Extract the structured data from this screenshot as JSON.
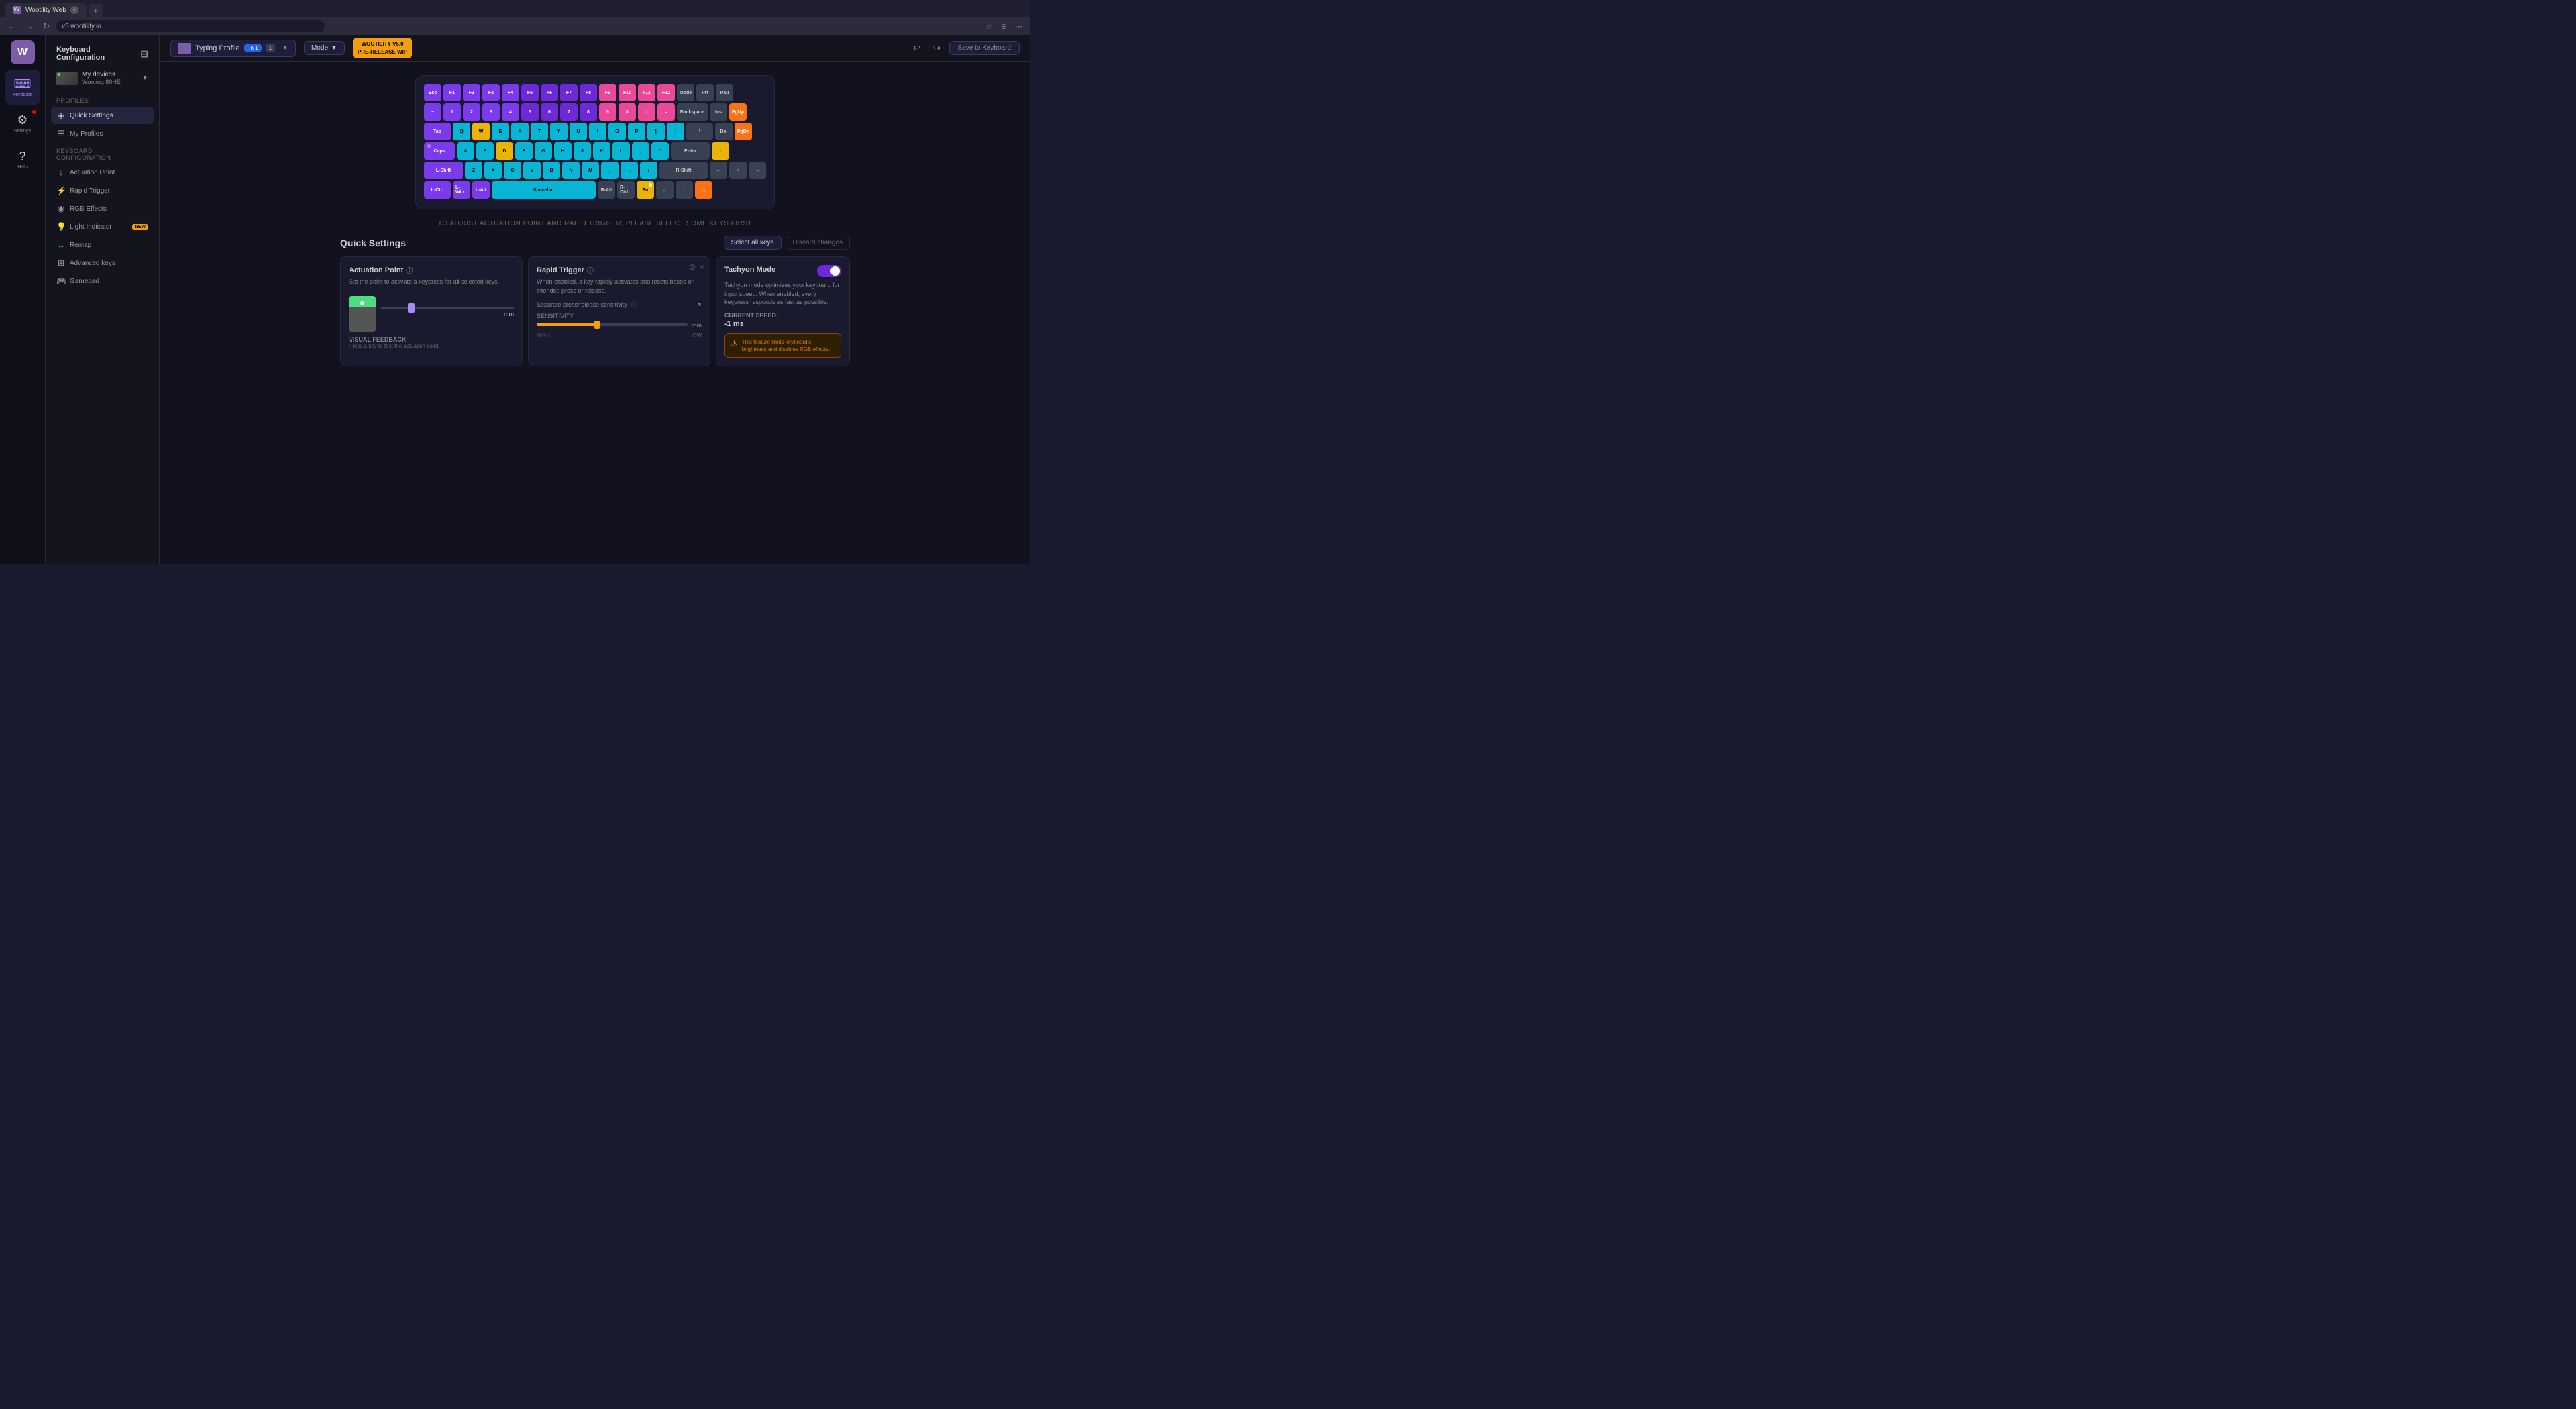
{
  "browser": {
    "tab_title": "Wootility Web",
    "url": "v5.wootility.io",
    "favicon": "W"
  },
  "sidebar": {
    "logo": "W",
    "items": [
      {
        "id": "keyboard",
        "icon": "⌨",
        "label": "Keyboard",
        "active": true
      },
      {
        "id": "settings",
        "icon": "⚙",
        "label": "Settings",
        "has_dot": true
      },
      {
        "id": "help",
        "icon": "?",
        "label": "Help"
      }
    ]
  },
  "nav_panel": {
    "title": "Keyboard Configuration",
    "device": {
      "name": "My devices",
      "model": "Wooting 80HE"
    },
    "sections": {
      "profiles": {
        "title": "Profiles",
        "items": [
          {
            "id": "quick-settings",
            "icon": "◈",
            "label": "Quick Settings",
            "active": true
          },
          {
            "id": "my-profiles",
            "icon": "☰",
            "label": "My Profiles"
          }
        ]
      },
      "keyboard_config": {
        "title": "Keyboard Configuration",
        "items": [
          {
            "id": "actuation-point",
            "icon": "↓",
            "label": "Actuation Point"
          },
          {
            "id": "rapid-trigger",
            "icon": "⚡",
            "label": "Rapid Trigger"
          },
          {
            "id": "rgb-effects",
            "icon": "◉",
            "label": "RGB Effects"
          },
          {
            "id": "light-indicator",
            "icon": "💡",
            "label": "Light Indicator",
            "badge": "NEW"
          },
          {
            "id": "remap",
            "icon": "↔",
            "label": "Remap"
          },
          {
            "id": "advanced-keys",
            "icon": "⊞",
            "label": "Advanced keys"
          },
          {
            "id": "gamepad",
            "icon": "🎮",
            "label": "Gamepad"
          }
        ]
      }
    }
  },
  "top_bar": {
    "profile_name": "Typing Profile",
    "profile_badge": "Fn 1",
    "profile_num": "1",
    "mode": "Mode",
    "wootility_line1": "WOOTILITY V5.0",
    "wootility_line2": "PRE-RELEASE WIP",
    "save_label": "Save to Keyboard",
    "undo_icon": "↩",
    "redo_icon": "↪"
  },
  "keyboard": {
    "rows": [
      {
        "keys": [
          {
            "label": "Esc",
            "color": "purple",
            "w": "w1"
          },
          {
            "label": "F1",
            "color": "purple",
            "w": "w1"
          },
          {
            "label": "F2",
            "color": "purple",
            "w": "w1"
          },
          {
            "label": "F3",
            "color": "purple",
            "w": "w1"
          },
          {
            "label": "F4",
            "color": "purple",
            "w": "w1"
          },
          {
            "label": "F5",
            "color": "violet",
            "w": "w1"
          },
          {
            "label": "F6",
            "color": "violet",
            "w": "w1"
          },
          {
            "label": "F7",
            "color": "violet",
            "w": "w1"
          },
          {
            "label": "F8",
            "color": "violet",
            "w": "w1"
          },
          {
            "label": "F9",
            "color": "pink",
            "w": "w1"
          },
          {
            "label": "F10",
            "color": "pink",
            "w": "w1"
          },
          {
            "label": "F11",
            "color": "pink",
            "w": "w1"
          },
          {
            "label": "F12",
            "color": "pink",
            "w": "w1"
          },
          {
            "label": "Mode",
            "color": "gray",
            "w": "w1"
          },
          {
            "label": "Prt",
            "color": "gray",
            "w": "w1"
          },
          {
            "label": "Pau",
            "color": "gray",
            "w": "w1"
          }
        ]
      },
      {
        "keys": [
          {
            "label": "~",
            "color": "purple",
            "w": "w1"
          },
          {
            "label": "1",
            "color": "purple",
            "w": "w1"
          },
          {
            "label": "2",
            "color": "purple",
            "w": "w1"
          },
          {
            "label": "3",
            "color": "purple",
            "w": "w1"
          },
          {
            "label": "4",
            "color": "purple",
            "w": "w1"
          },
          {
            "label": "5",
            "color": "violet",
            "w": "w1"
          },
          {
            "label": "6",
            "color": "violet",
            "w": "w1"
          },
          {
            "label": "7",
            "color": "violet",
            "w": "w1"
          },
          {
            "label": "8",
            "color": "violet",
            "w": "w1"
          },
          {
            "label": "9",
            "color": "pink",
            "w": "w1"
          },
          {
            "label": "0",
            "color": "pink",
            "w": "w1"
          },
          {
            "label": "-",
            "color": "pink",
            "w": "w1"
          },
          {
            "label": "=",
            "color": "pink",
            "w": "w1"
          },
          {
            "label": "Backspace",
            "color": "gray",
            "w": "w175"
          },
          {
            "label": "Ins",
            "color": "gray",
            "w": "w1"
          },
          {
            "label": "PgUp",
            "color": "orange",
            "w": "w1"
          }
        ]
      },
      {
        "keys": [
          {
            "label": "Tab",
            "color": "purple",
            "w": "w15"
          },
          {
            "label": "Q",
            "color": "cyan",
            "w": "w1"
          },
          {
            "label": "W",
            "color": "yellow",
            "w": "w1"
          },
          {
            "label": "E",
            "color": "cyan",
            "w": "w1"
          },
          {
            "label": "R",
            "color": "cyan",
            "w": "w1"
          },
          {
            "label": "T",
            "color": "cyan",
            "w": "w1"
          },
          {
            "label": "Y",
            "color": "cyan",
            "w": "w1"
          },
          {
            "label": "U",
            "color": "cyan",
            "w": "w1"
          },
          {
            "label": "I",
            "color": "cyan",
            "w": "w1"
          },
          {
            "label": "O",
            "color": "cyan",
            "w": "w1"
          },
          {
            "label": "P",
            "color": "cyan",
            "w": "w1"
          },
          {
            "label": "[",
            "color": "cyan",
            "w": "w1"
          },
          {
            "label": "]",
            "color": "cyan",
            "w": "w1"
          },
          {
            "label": "\\",
            "color": "gray",
            "w": "w15"
          },
          {
            "label": "Del",
            "color": "gray",
            "w": "w1"
          },
          {
            "label": "PgDn",
            "color": "orange",
            "w": "w1"
          }
        ]
      },
      {
        "keys": [
          {
            "label": "Caps",
            "color": "purple",
            "w": "w175"
          },
          {
            "label": "A",
            "color": "cyan",
            "w": "w1"
          },
          {
            "label": "S",
            "color": "cyan",
            "w": "w1"
          },
          {
            "label": "D",
            "color": "yellow",
            "w": "w1"
          },
          {
            "label": "F",
            "color": "cyan",
            "w": "w1"
          },
          {
            "label": "G",
            "color": "cyan",
            "w": "w1"
          },
          {
            "label": "H",
            "color": "cyan",
            "w": "w1"
          },
          {
            "label": "J",
            "color": "cyan",
            "w": "w1"
          },
          {
            "label": "K",
            "color": "cyan",
            "w": "w1"
          },
          {
            "label": "L",
            "color": "cyan",
            "w": "w1"
          },
          {
            "label": ";",
            "color": "cyan",
            "w": "w1"
          },
          {
            "label": "'",
            "color": "cyan",
            "w": "w1"
          },
          {
            "label": "Enter",
            "color": "gray",
            "w": "w225"
          },
          {
            "label": "↑",
            "color": "yellow",
            "w": "w1"
          }
        ]
      },
      {
        "keys": [
          {
            "label": "L-Shift",
            "color": "purple",
            "w": "w225"
          },
          {
            "label": "Z",
            "color": "cyan",
            "w": "w1"
          },
          {
            "label": "X",
            "color": "cyan",
            "w": "w1"
          },
          {
            "label": "C",
            "color": "cyan",
            "w": "w1"
          },
          {
            "label": "V",
            "color": "cyan",
            "w": "w1"
          },
          {
            "label": "B",
            "color": "cyan",
            "w": "w1"
          },
          {
            "label": "N",
            "color": "cyan",
            "w": "w1"
          },
          {
            "label": "M",
            "color": "cyan",
            "w": "w1"
          },
          {
            "label": ",",
            "color": "cyan",
            "w": "w1"
          },
          {
            "label": ".",
            "color": "cyan",
            "w": "w1"
          },
          {
            "label": "/",
            "color": "cyan",
            "w": "w1"
          },
          {
            "label": "R-Shift",
            "color": "gray",
            "w": "w275"
          },
          {
            "label": "←",
            "color": "gray",
            "w": "w1"
          },
          {
            "label": "↑",
            "color": "gray",
            "w": "w1"
          },
          {
            "label": "→",
            "color": "gray",
            "w": "w1"
          }
        ]
      },
      {
        "keys": [
          {
            "label": "L-Ctrl",
            "color": "purple",
            "w": "w15"
          },
          {
            "label": "L-Win",
            "color": "purple",
            "w": "w1"
          },
          {
            "label": "L-Alt",
            "color": "purple",
            "w": "w1"
          },
          {
            "label": "Spacebar",
            "color": "cyan",
            "w": "w6"
          },
          {
            "label": "R-Alt",
            "color": "gray",
            "w": "w1"
          },
          {
            "label": "R-Ctrl",
            "color": "gray",
            "w": "w1"
          },
          {
            "label": "Fn",
            "color": "yellow",
            "w": "w1"
          },
          {
            "label": "←",
            "color": "gray",
            "w": "w1"
          },
          {
            "label": "↓",
            "color": "gray",
            "w": "w1"
          },
          {
            "label": "→",
            "color": "orange",
            "w": "w1"
          }
        ]
      }
    ]
  },
  "instruction": {
    "text": "TO ADJUST ACTUATION POINT AND RAPID TRIGGER, PLEASE SELECT SOME KEYS FIRST"
  },
  "quick_settings": {
    "title": "Quick Settings",
    "select_all_label": "Select all keys",
    "discard_label": "Discard changes",
    "actuation_point": {
      "title": "Actuation Point",
      "desc": "Set the point to activate a keypress for all selected keys.",
      "value": "mm",
      "visual_feedback_title": "VISUAL FEEDBACK",
      "visual_feedback_desc": "Press a key to test the actuation point."
    },
    "rapid_trigger": {
      "title": "Rapid Trigger",
      "desc": "When enabled, a key rapidly activates and resets based on intended press or release.",
      "separate_label": "Separate press/release sensitivity",
      "sensitivity_label": "SENSITIVITY",
      "high_label": "HIGH",
      "low_label": "LOW",
      "mm_label": "mm"
    },
    "tachyon_mode": {
      "title": "Tachyon Mode",
      "desc": "Tachyon mode optimizes your keyboard for input speed. When enabled, every keypress responds as fast as possible.",
      "current_speed_label": "CURRENT SPEED:",
      "current_speed_value": "-1 ms",
      "warning_text": "This feature limits keyboard's brightness and disables RGB effects."
    }
  }
}
